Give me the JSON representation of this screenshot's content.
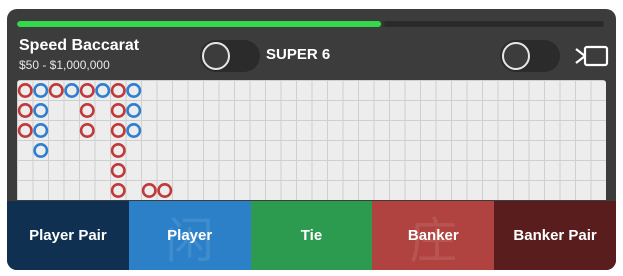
{
  "header": {
    "table_name": "Speed Baccarat",
    "bet_limits": "$50 - $1,000,000",
    "super6_label": "SUPER 6"
  },
  "progress": {
    "fraction": 0.62,
    "color": "#33d94a"
  },
  "toggles": {
    "super6": {
      "on": false
    },
    "right": {
      "on": false
    }
  },
  "icons": {
    "cast": "cast-screen-icon"
  },
  "colors": {
    "banker_ring": "#c03a3a",
    "player_ring": "#2f7fd0",
    "player_pair": "#0f3050",
    "player": "#2b80c8",
    "tie": "#2c9a4f",
    "banker": "#b0423f",
    "banker_pair": "#5a1d1d"
  },
  "bead_road": [
    [
      "B",
      "B",
      "B",
      null,
      null,
      null
    ],
    [
      "P",
      "P",
      "P",
      "P",
      null,
      null
    ],
    [
      "B",
      null,
      null,
      null,
      null,
      null
    ],
    [
      "P",
      null,
      null,
      null,
      null,
      null
    ],
    [
      "B",
      "B",
      "B",
      null,
      null,
      null
    ],
    [
      "P",
      null,
      null,
      null,
      null,
      null
    ],
    [
      "B",
      "B",
      "B",
      "B",
      "B",
      "B"
    ],
    [
      "P",
      "P",
      "P",
      null,
      null,
      null
    ],
    [
      null,
      null,
      null,
      null,
      null,
      "B"
    ],
    [
      null,
      null,
      null,
      null,
      null,
      "B"
    ]
  ],
  "bets": [
    {
      "key": "player_pair",
      "label": "Player Pair",
      "watermark": ""
    },
    {
      "key": "player",
      "label": "Player",
      "watermark": "闲"
    },
    {
      "key": "tie",
      "label": "Tie",
      "watermark": ""
    },
    {
      "key": "banker",
      "label": "Banker",
      "watermark": "庄"
    },
    {
      "key": "banker_pair",
      "label": "Banker Pair",
      "watermark": ""
    }
  ]
}
